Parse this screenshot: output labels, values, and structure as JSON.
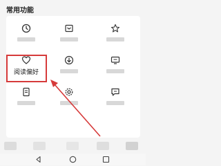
{
  "section": {
    "title": "常用功能"
  },
  "functions": [
    {
      "icon": "clock-icon",
      "label": ""
    },
    {
      "icon": "mail-download-icon",
      "label": ""
    },
    {
      "icon": "star-icon",
      "label": ""
    },
    {
      "icon": "heart-icon",
      "label": "阅读偏好"
    },
    {
      "icon": "download-icon",
      "label": ""
    },
    {
      "icon": "monitor-icon",
      "label": ""
    },
    {
      "icon": "document-icon",
      "label": ""
    },
    {
      "icon": "gear-icon",
      "label": ""
    },
    {
      "icon": "message-icon",
      "label": ""
    }
  ],
  "highlight": {
    "color": "#d63a3a"
  },
  "colors": {
    "background": "#f4f4f4",
    "card": "#ffffff",
    "icon": "#333333"
  }
}
